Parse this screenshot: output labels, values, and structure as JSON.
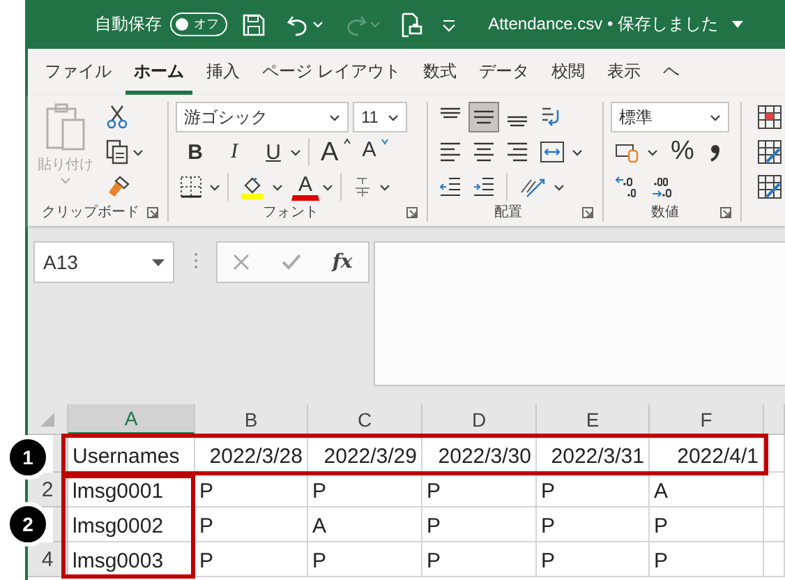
{
  "title_bar": {
    "autosave_label": "自動保存",
    "autosave_toggle": {
      "label": "オフ",
      "on": false
    },
    "redo": {
      "disabled": true
    },
    "document_title": "Attendance.csv • 保存しました"
  },
  "tabs": [
    {
      "label": "ファイル",
      "selected": false
    },
    {
      "label": "ホーム",
      "selected": true
    },
    {
      "label": "挿入",
      "selected": false
    },
    {
      "label": "ページ レイアウト",
      "selected": false
    },
    {
      "label": "数式",
      "selected": false
    },
    {
      "label": "データ",
      "selected": false
    },
    {
      "label": "校閲",
      "selected": false
    },
    {
      "label": "表示",
      "selected": false
    },
    {
      "label": "ヘ",
      "selected": false
    }
  ],
  "ribbon": {
    "clipboard": {
      "label": "クリップボード",
      "paste": {
        "label": "貼り付け",
        "disabled": true
      }
    },
    "font": {
      "label": "フォント",
      "font_name": "游ゴシック",
      "font_size": "11",
      "style_buttons": [
        "B",
        "I",
        "U"
      ],
      "size_buttons": [
        "A",
        "A"
      ],
      "font_color_button": "A"
    },
    "alignment": {
      "label": "配置",
      "vertical_align": [
        {
          "selected": false
        },
        {
          "selected": true
        },
        {
          "selected": false
        }
      ]
    },
    "number": {
      "label": "数値",
      "format": "標準",
      "percent_button": "%"
    }
  },
  "formula_bar": {
    "name_box": "A13",
    "function_button": "fx"
  },
  "sheet": {
    "columns": [
      {
        "label": "A",
        "selected": true
      },
      {
        "label": "B",
        "selected": false
      },
      {
        "label": "C",
        "selected": false
      },
      {
        "label": "D",
        "selected": false
      },
      {
        "label": "E",
        "selected": false
      },
      {
        "label": "F",
        "selected": false
      }
    ],
    "rows": [
      {
        "cells": [
          {
            "text": "Usernames",
            "kind": "text"
          },
          {
            "text": "2022/3/28",
            "kind": "date"
          },
          {
            "text": "2022/3/29",
            "kind": "date"
          },
          {
            "text": "2022/3/30",
            "kind": "date"
          },
          {
            "text": "2022/3/31",
            "kind": "date"
          },
          {
            "text": "2022/4/1",
            "kind": "date"
          }
        ]
      },
      {
        "number": "2",
        "cells": [
          {
            "text": "lmsg0001",
            "kind": "text"
          },
          {
            "text": "P",
            "kind": "text"
          },
          {
            "text": "P",
            "kind": "text"
          },
          {
            "text": "P",
            "kind": "text"
          },
          {
            "text": "P",
            "kind": "text"
          },
          {
            "text": "A",
            "kind": "text"
          }
        ]
      },
      {
        "cells": [
          {
            "text": "lmsg0002",
            "kind": "text"
          },
          {
            "text": "P",
            "kind": "text"
          },
          {
            "text": "A",
            "kind": "text"
          },
          {
            "text": "P",
            "kind": "text"
          },
          {
            "text": "P",
            "kind": "text"
          },
          {
            "text": "P",
            "kind": "text"
          }
        ]
      },
      {
        "number": "4",
        "cells": [
          {
            "text": "lmsg0003",
            "kind": "text"
          },
          {
            "text": "P",
            "kind": "text"
          },
          {
            "text": "P",
            "kind": "text"
          },
          {
            "text": "P",
            "kind": "text"
          },
          {
            "text": "P",
            "kind": "text"
          },
          {
            "text": "P",
            "kind": "text"
          }
        ]
      }
    ]
  },
  "annotations": [
    {
      "label": "1",
      "kind": "row-frame"
    },
    {
      "label": "2",
      "kind": "column-frame"
    }
  ]
}
